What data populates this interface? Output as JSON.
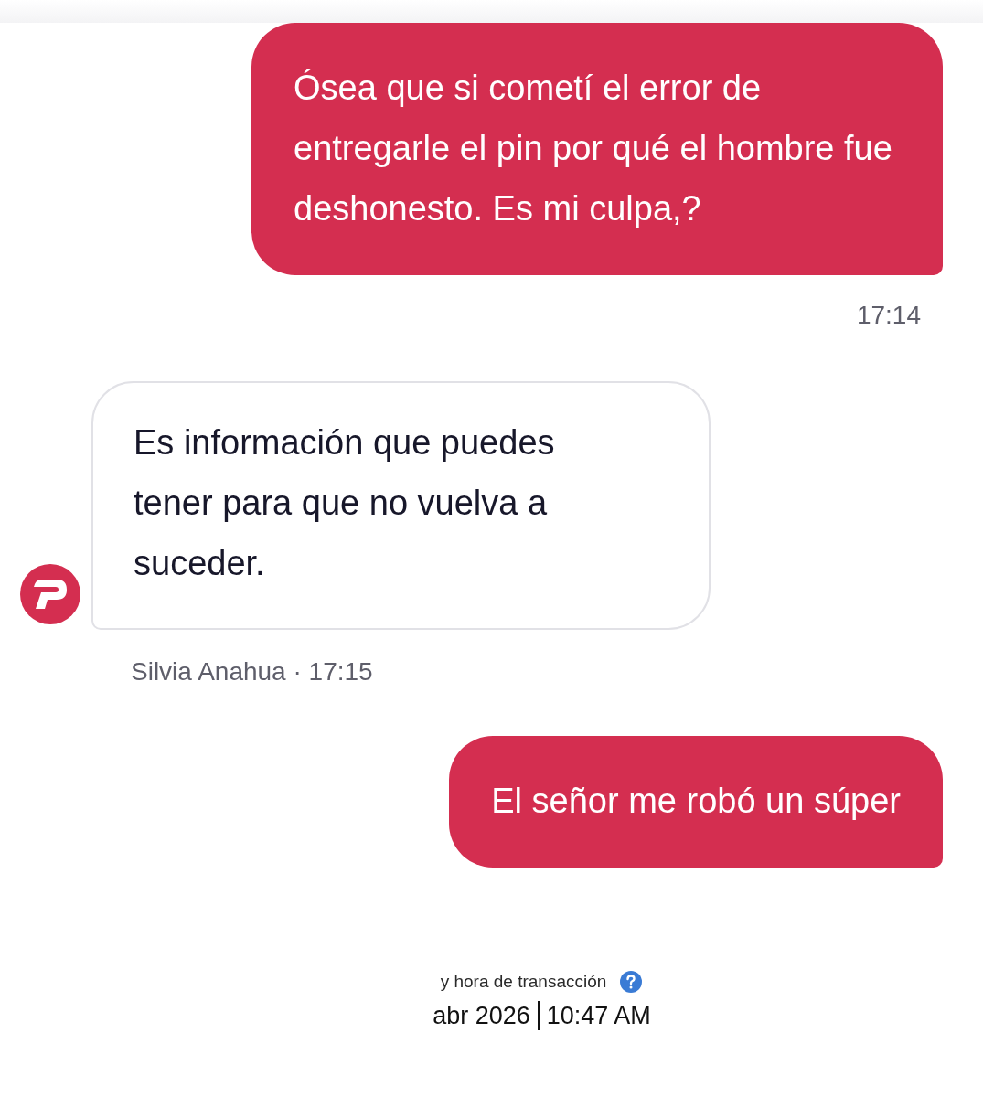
{
  "messages": [
    {
      "kind": "sent",
      "text": "Ósea que si cometí el error de entregarle el pin por qué el hombre fue deshonesto. Es mi culpa,?",
      "time": "17:14"
    },
    {
      "kind": "received",
      "text": "Es información que puedes tener para que no vuelva a suceder.",
      "sender": "Silvia Anahua",
      "separator": "·",
      "time": "17:15"
    },
    {
      "kind": "sent",
      "text": "El señor me robó un súper"
    }
  ],
  "transaction": {
    "label": "y hora de transacción",
    "date": "abr 2026",
    "time": "10:47 AM"
  }
}
